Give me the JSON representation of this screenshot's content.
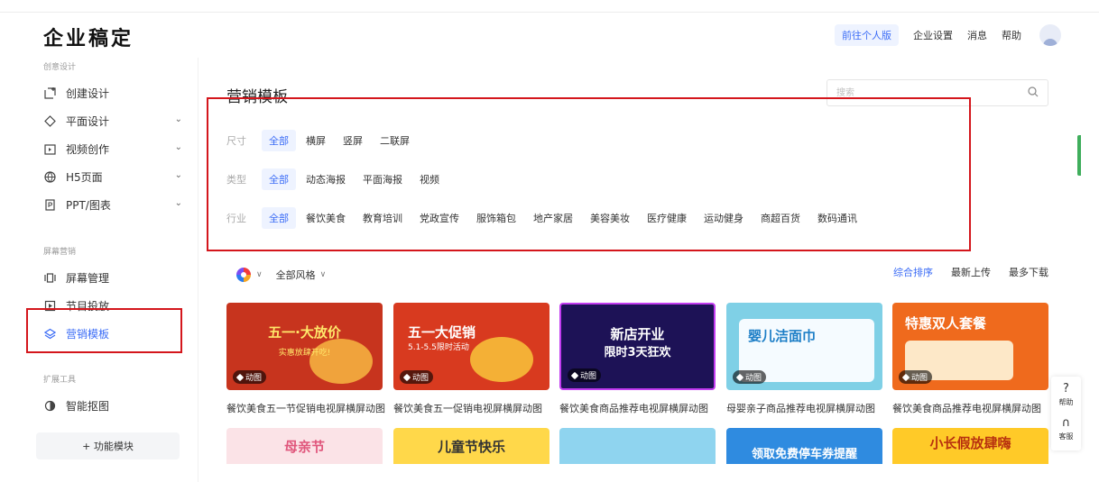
{
  "header": {
    "logo": "企业稿定",
    "personal_btn": "前往个人版",
    "links": [
      "企业设置",
      "消息",
      "帮助"
    ]
  },
  "sidebar": {
    "sections": [
      "创意设计",
      "屏幕营销",
      "扩展工具"
    ],
    "items": [
      {
        "label": "创建设计",
        "icon": "create-icon"
      },
      {
        "label": "平面设计",
        "icon": "diamond-icon"
      },
      {
        "label": "视频创作",
        "icon": "video-icon"
      },
      {
        "label": "H5页面",
        "icon": "globe-icon"
      },
      {
        "label": "PPT/图表",
        "icon": "ppt-icon"
      },
      {
        "label": "屏幕管理",
        "icon": "screen-icon"
      },
      {
        "label": "节目投放",
        "icon": "play-icon"
      },
      {
        "label": "营销模板",
        "icon": "layers-icon"
      },
      {
        "label": "智能抠图",
        "icon": "cutout-icon"
      }
    ],
    "add_module": "+ 功能模块"
  },
  "main": {
    "title": "营销模板",
    "search_placeholder": "搜索",
    "filters": {
      "size": {
        "label": "尺寸",
        "options": [
          "全部",
          "横屏",
          "竖屏",
          "二联屏"
        ]
      },
      "type": {
        "label": "类型",
        "options": [
          "全部",
          "动态海报",
          "平面海报",
          "视频"
        ]
      },
      "industry": {
        "label": "行业",
        "options": [
          "全部",
          "餐饮美食",
          "教育培训",
          "党政宣传",
          "服饰箱包",
          "地产家居",
          "美容美妆",
          "医疗健康",
          "运动健身",
          "商超百货",
          "数码通讯"
        ]
      }
    },
    "style_filter": "全部风格",
    "sort": [
      "综合排序",
      "最新上传",
      "最多下载"
    ],
    "cards": [
      {
        "caption": "餐饮美食五一节促销电视屏横屏动图",
        "badge": "动图",
        "headline": "五一·大放价",
        "sub": "实惠放肆开吃!",
        "bg": "#c7341e",
        "fg": "#ffe76a"
      },
      {
        "caption": "餐饮美食五一促销电视屏横屏动图",
        "badge": "动图",
        "headline": "五一大促销",
        "sub": "5.1-5.5限时活动",
        "bg": "#d83a1f",
        "fg": "#ffffff"
      },
      {
        "caption": "餐饮美食商品推荐电视屏横屏动图",
        "badge": "动图",
        "headline": "新店开业",
        "sub": "限时3天狂欢",
        "bg": "#1d1256",
        "fg": "#ffffff"
      },
      {
        "caption": "母婴亲子商品推荐电视屏横屏动图",
        "badge": "动图",
        "headline": "婴儿洁面巾",
        "sub": "",
        "bg": "#7fd0e6",
        "fg": "#1e7fc7"
      },
      {
        "caption": "餐饮美食商品推荐电视屏横屏动图",
        "badge": "动图",
        "headline": "特惠双人套餐",
        "sub": "",
        "bg": "#ef6a1d",
        "fg": "#ffffff"
      }
    ],
    "cards_row2": [
      {
        "headline": "母亲节",
        "bg": "#fbe3e7",
        "fg": "#e0567c"
      },
      {
        "headline": "儿童节快乐",
        "bg": "#ffd84a",
        "fg": "#333333"
      },
      {
        "headline": "",
        "bg": "#8fd4ef",
        "fg": "#ffffff"
      },
      {
        "headline": "领取免费停车券提醒",
        "bg": "#2f8be0",
        "fg": "#ffffff"
      },
      {
        "headline": "小长假放肆嗨",
        "bg": "#ffca28",
        "fg": "#b8310f"
      }
    ]
  },
  "float": {
    "help": "帮助",
    "service": "客服"
  }
}
